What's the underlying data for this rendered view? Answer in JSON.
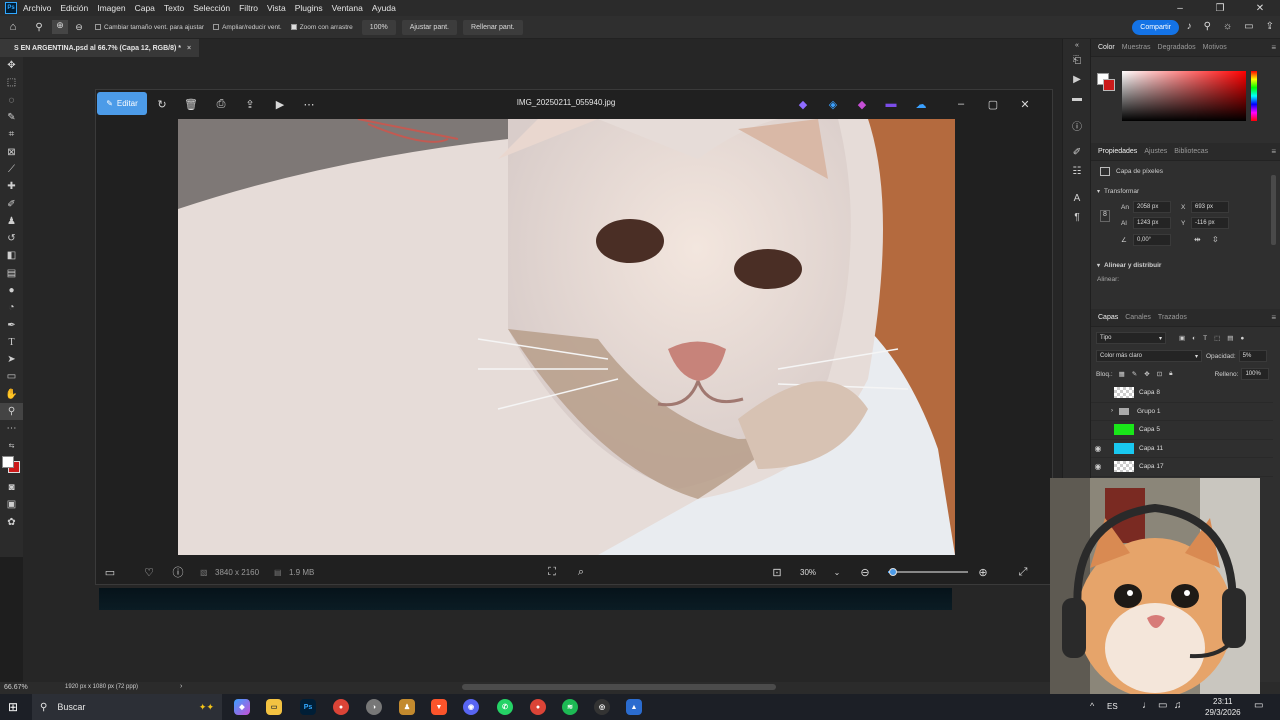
{
  "menubar": {
    "logo": "Ps",
    "items": [
      "Archivo",
      "Edición",
      "Imagen",
      "Capa",
      "Texto",
      "Selección",
      "Filtro",
      "Vista",
      "Plugins",
      "Ventana",
      "Ayuda"
    ]
  },
  "optionsbar": {
    "resize_windows": "Cambiar tamaño vent. para ajustar",
    "zoom_all": "Ampliar/reducir vent.",
    "scrubby_zoom": "Zoom con arrastre",
    "zoom_100": "100%",
    "fit_screen": "Ajustar pant.",
    "fill_screen": "Rellenar pant.",
    "share": "Compartir"
  },
  "document": {
    "tab_title": "S EN ARGENTINA.psd al 66.7% (Capa 12, RGB/8) *"
  },
  "photos_app": {
    "edit_label": "Editar",
    "file_name": "IMG_20250211_055940.jpg",
    "dimensions": "3840 x 2160",
    "file_size": "1.9 MB",
    "zoom": "30%",
    "zoom_fraction": 0.06
  },
  "color_panel": {
    "tabs": [
      "Color",
      "Muestras",
      "Degradados",
      "Motivos"
    ],
    "foreground": "#ffffff",
    "background": "#cc1a1a",
    "hue": "#ff0000"
  },
  "properties_panel": {
    "tabs": [
      "Propiedades",
      "Ajustes",
      "Bibliotecas"
    ],
    "layer_type": "Capa de píxeles",
    "transform_label": "Transformar",
    "w_label": "An",
    "w_value": "2058 px",
    "h_label": "Al",
    "h_value": "1243 px",
    "x_label": "X",
    "x_value": "693 px",
    "y_label": "Y",
    "y_value": "-116 px",
    "angle_value": "0,00°",
    "align_section": "Alinear y distribuir",
    "align_label": "Alinear:"
  },
  "layers_panel": {
    "tabs": [
      "Capas",
      "Canales",
      "Trazados"
    ],
    "filter_label": "Tipo",
    "blend_mode": "Color más claro",
    "opacity_label": "Opacidad:",
    "opacity_value": "5%",
    "lock_label": "Bloq.:",
    "fill_label": "Relleno:",
    "fill_value": "100%",
    "layers": [
      {
        "name": "Capa 8",
        "visible": false,
        "thumb": "checker"
      },
      {
        "name": "Grupo 1",
        "visible": false,
        "thumb": "folder"
      },
      {
        "name": "Capa 5",
        "visible": false,
        "thumb": "#19e619"
      },
      {
        "name": "Capa 11",
        "visible": true,
        "thumb": "#19c8f0"
      },
      {
        "name": "Capa 17",
        "visible": true,
        "thumb": "checker"
      }
    ]
  },
  "statusbar": {
    "zoom": "66.67%",
    "doc_info": "1920 px x 1080 px (72 ppp)"
  },
  "taskbar": {
    "search_placeholder": "Buscar",
    "language": "ES",
    "time": "23:11",
    "date": "29/3/2026"
  }
}
